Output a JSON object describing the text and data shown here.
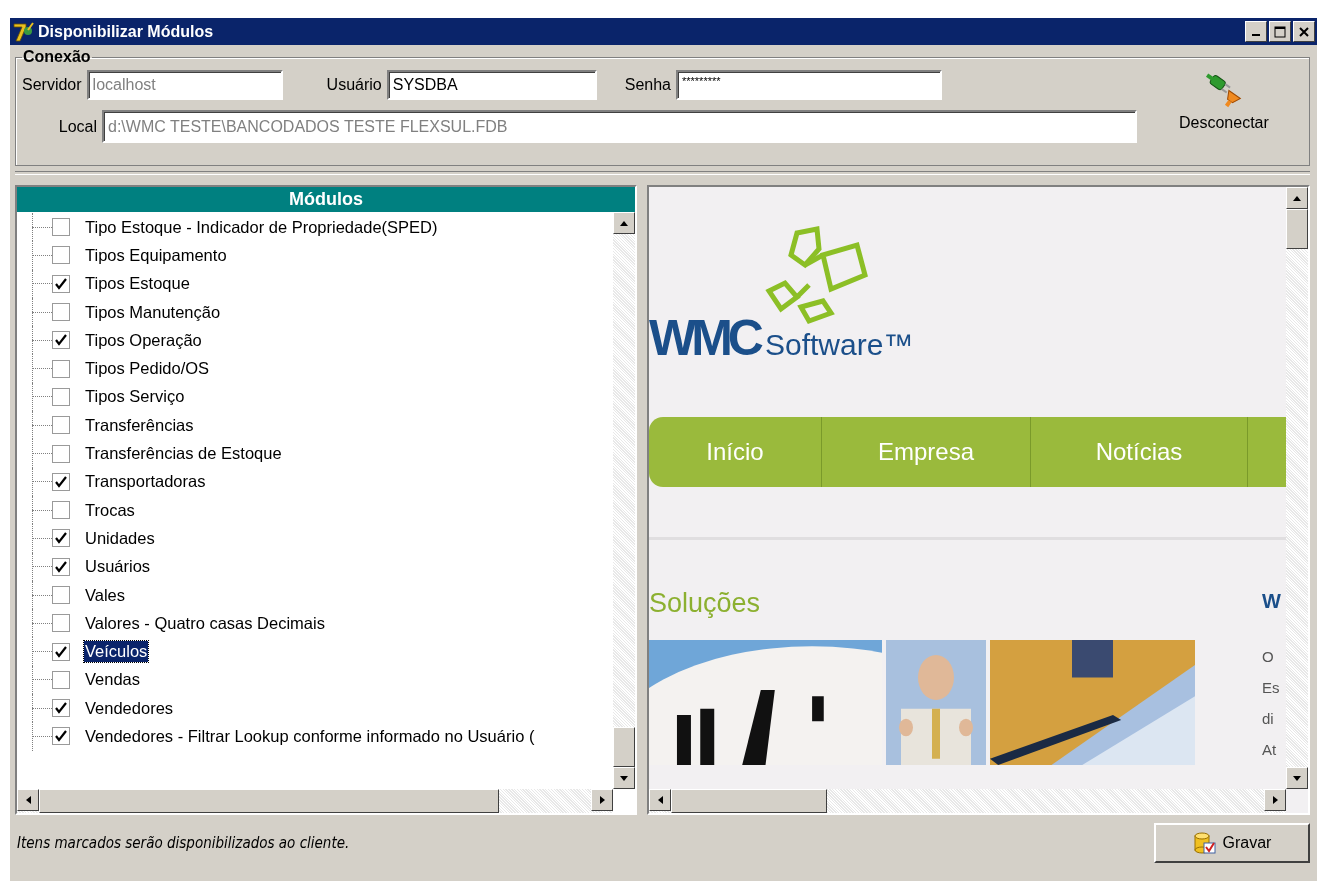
{
  "window": {
    "title": "Disponibilizar Módulos"
  },
  "connection": {
    "title": "Conexão",
    "fields": [
      {
        "label": "Servidor",
        "value": "localhost",
        "disabled": true
      },
      {
        "label": "Usuário",
        "value": "SYSDBA",
        "disabled": false
      },
      {
        "label": "Senha",
        "value": "*********",
        "disabled": false
      },
      {
        "label": "Local",
        "value": "d:\\WMC TESTE\\BANCODADOS TESTE FLEXSUL.FDB",
        "disabled": true
      }
    ],
    "disconnect_button": {
      "label": "Desconectar"
    }
  },
  "modules": {
    "title": "Módulos",
    "items": [
      {
        "label": "Tipo Estoque - Indicador de Propriedade(SPED)",
        "checked": false,
        "selected": false
      },
      {
        "label": "Tipos Equipamento",
        "checked": false,
        "selected": false
      },
      {
        "label": "Tipos Estoque",
        "checked": true,
        "selected": false
      },
      {
        "label": "Tipos Manutenção",
        "checked": false,
        "selected": false
      },
      {
        "label": "Tipos Operação",
        "checked": true,
        "selected": false
      },
      {
        "label": "Tipos Pedido/OS",
        "checked": false,
        "selected": false
      },
      {
        "label": "Tipos Serviço",
        "checked": false,
        "selected": false
      },
      {
        "label": "Transferências",
        "checked": false,
        "selected": false
      },
      {
        "label": "Transferências de Estoque",
        "checked": false,
        "selected": false
      },
      {
        "label": "Transportadoras",
        "checked": true,
        "selected": false
      },
      {
        "label": "Trocas",
        "checked": false,
        "selected": false
      },
      {
        "label": "Unidades",
        "checked": true,
        "selected": false
      },
      {
        "label": "Usuários",
        "checked": true,
        "selected": false
      },
      {
        "label": "Vales",
        "checked": false,
        "selected": false
      },
      {
        "label": "Valores - Quatro casas Decimais",
        "checked": false,
        "selected": false
      },
      {
        "label": "Veículos",
        "checked": true,
        "selected": true
      },
      {
        "label": "Vendas",
        "checked": false,
        "selected": false
      },
      {
        "label": "Vendedores",
        "checked": true,
        "selected": false
      },
      {
        "label": "Vendedores - Filtrar Lookup conforme informado no Usuário (",
        "checked": true,
        "selected": false
      }
    ]
  },
  "browser": {
    "logo_mark": "WMC",
    "logo_word": "Software™",
    "nav": [
      "Início",
      "Empresa",
      "Notícias"
    ],
    "heading": "Soluções",
    "side_heading": "W",
    "side_lines": [
      "O",
      "Es",
      "di",
      "At"
    ],
    "photos": [
      {
        "kind": "picture"
      },
      {
        "kind": "picture"
      },
      {
        "kind": "picture"
      }
    ]
  },
  "status_text": "Itens marcados serão disponibilizados ao cliente.",
  "save_button": {
    "label": "Gravar"
  }
}
